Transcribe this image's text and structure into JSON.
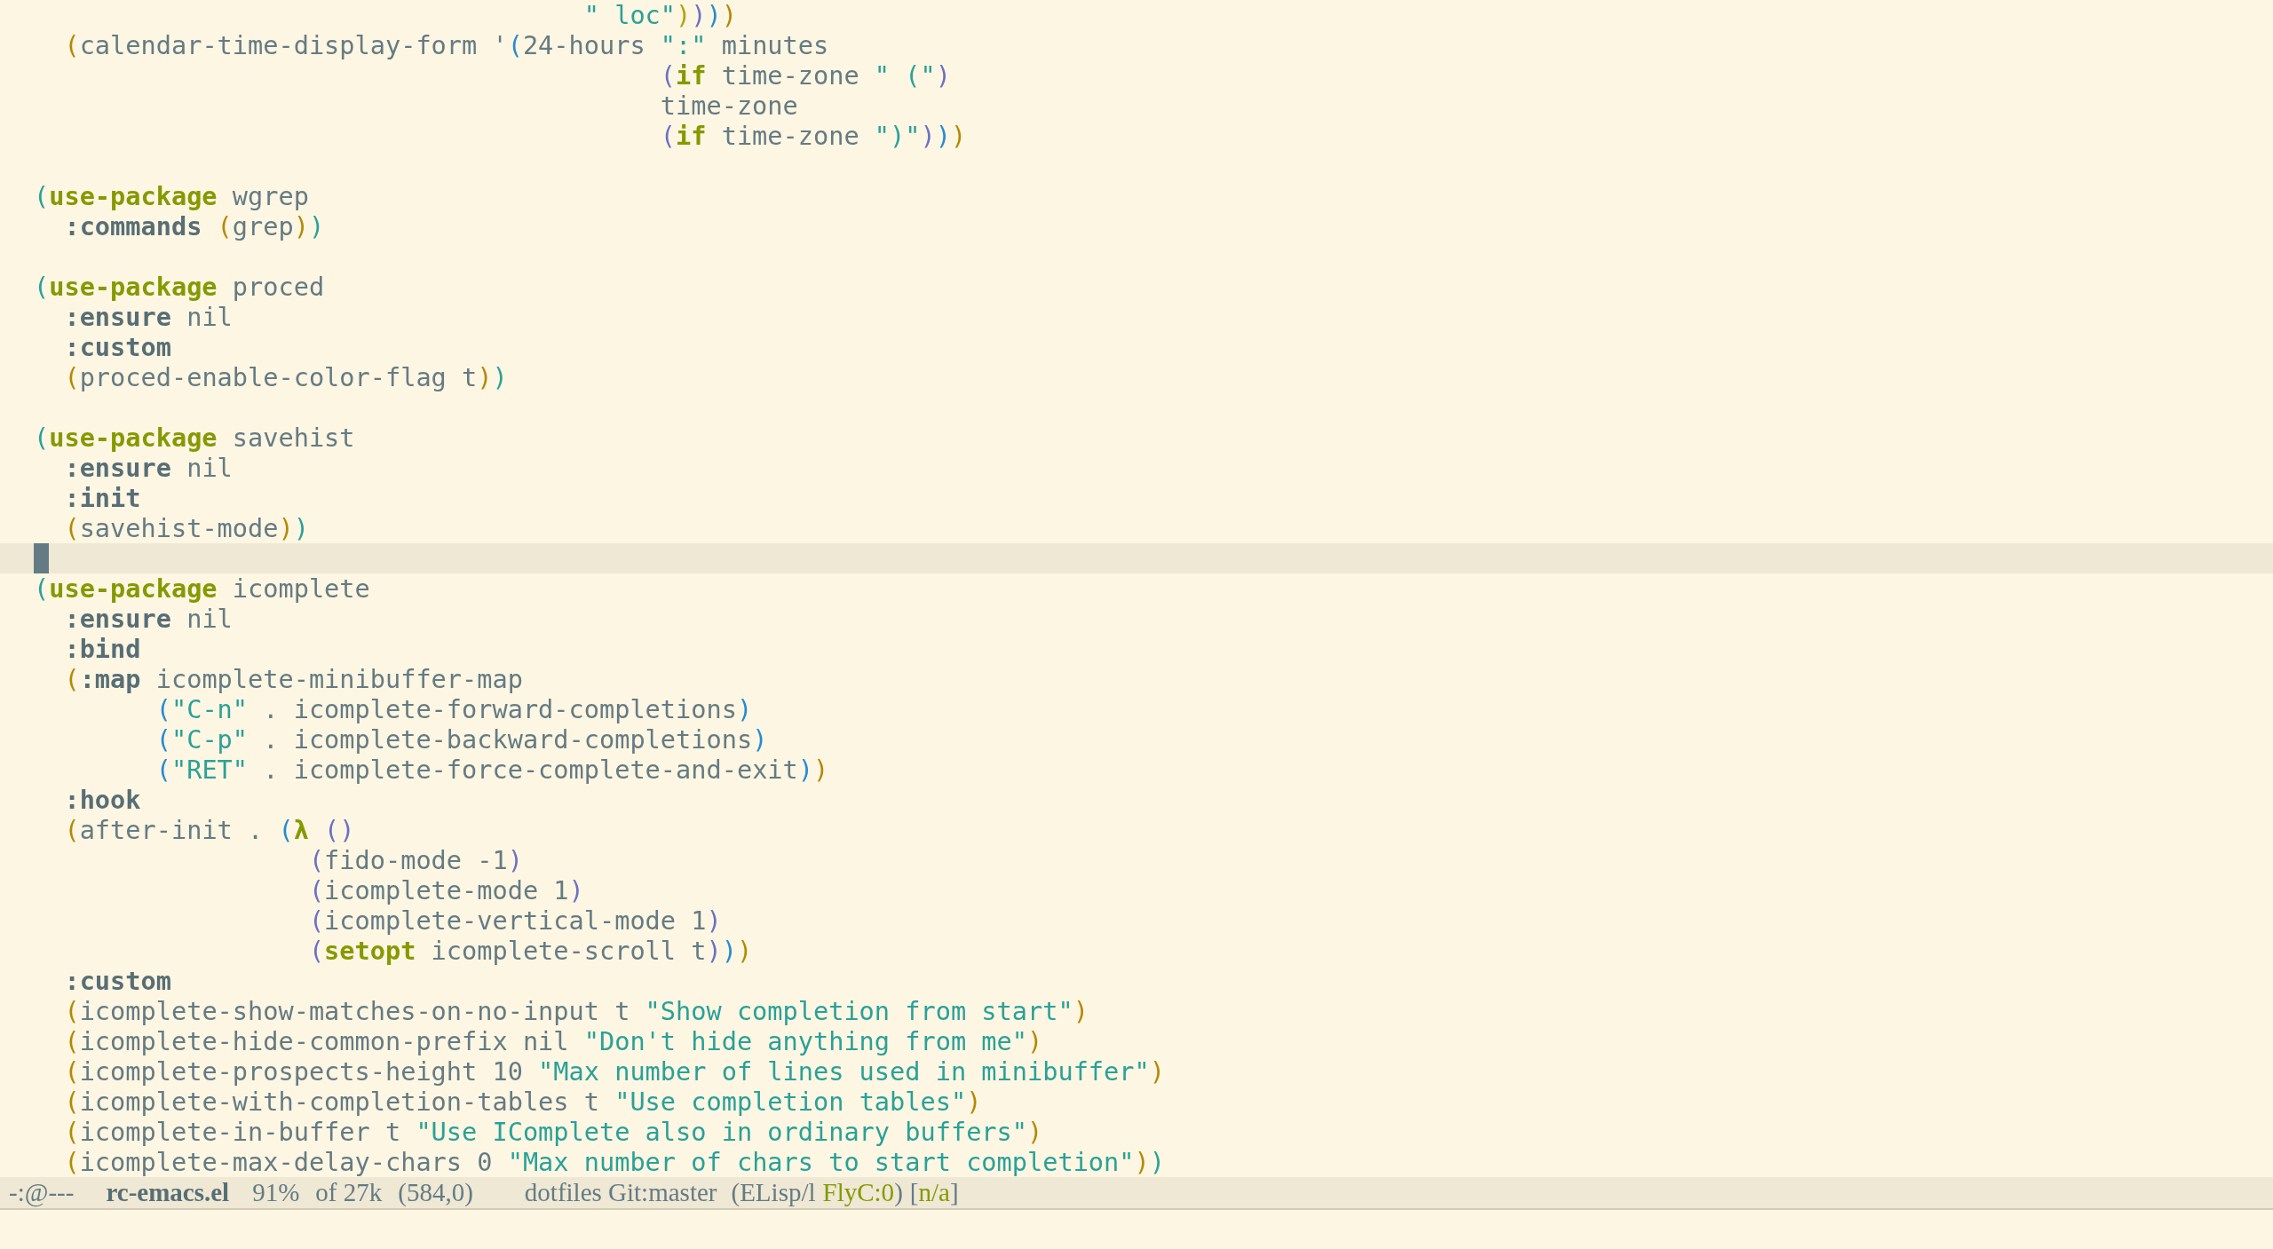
{
  "lines": [
    {
      "current": false,
      "tokens": [
        {
          "kind": "string",
          "text": "                                    \" loc\""
        },
        {
          "kind": "paren",
          "text": ")",
          "color": "#b3a300"
        },
        {
          "kind": "paren",
          "text": ")",
          "color": "#6c71c4"
        },
        {
          "kind": "paren",
          "text": ")",
          "color": "#268bd2"
        },
        {
          "kind": "paren",
          "text": ")",
          "color": "#b58900"
        }
      ]
    },
    {
      "current": false,
      "tokens": [
        {
          "kind": "paren",
          "text": "  (",
          "color": "#b58900"
        },
        {
          "kind": "plain",
          "text": "calendar-time-display-form '"
        },
        {
          "kind": "paren",
          "text": "(",
          "color": "#268bd2"
        },
        {
          "kind": "plain",
          "text": "24-hours "
        },
        {
          "kind": "string",
          "text": "\":\""
        },
        {
          "kind": "plain",
          "text": " minutes"
        }
      ]
    },
    {
      "current": false,
      "tokens": [
        {
          "kind": "paren",
          "text": "                                         (",
          "color": "#6c71c4"
        },
        {
          "kind": "keyword",
          "text": "if"
        },
        {
          "kind": "plain",
          "text": " time-zone "
        },
        {
          "kind": "string",
          "text": "\" (\""
        },
        {
          "kind": "paren",
          "text": ")",
          "color": "#6c71c4"
        }
      ]
    },
    {
      "current": false,
      "tokens": [
        {
          "kind": "plain",
          "text": "                                         time-zone"
        }
      ]
    },
    {
      "current": false,
      "tokens": [
        {
          "kind": "paren",
          "text": "                                         (",
          "color": "#6c71c4"
        },
        {
          "kind": "keyword",
          "text": "if"
        },
        {
          "kind": "plain",
          "text": " time-zone "
        },
        {
          "kind": "string",
          "text": "\")\""
        },
        {
          "kind": "paren",
          "text": ")",
          "color": "#6c71c4"
        },
        {
          "kind": "paren",
          "text": ")",
          "color": "#268bd2"
        },
        {
          "kind": "paren",
          "text": ")",
          "color": "#b58900"
        }
      ]
    },
    {
      "current": false
    },
    {
      "current": false,
      "tokens": [
        {
          "kind": "paren",
          "text": "(",
          "color": "#2aa198"
        },
        {
          "kind": "keyword",
          "text": "use-package"
        },
        {
          "kind": "plain",
          "text": " wgrep"
        }
      ]
    },
    {
      "current": false,
      "tokens": [
        {
          "kind": "property",
          "text": "  :commands"
        },
        {
          "kind": "paren",
          "text": " (",
          "color": "#b58900"
        },
        {
          "kind": "plain",
          "text": "grep"
        },
        {
          "kind": "paren",
          "text": ")",
          "color": "#b58900"
        },
        {
          "kind": "paren",
          "text": ")",
          "color": "#2aa198"
        }
      ]
    },
    {
      "current": false
    },
    {
      "current": false,
      "tokens": [
        {
          "kind": "paren",
          "text": "(",
          "color": "#2aa198"
        },
        {
          "kind": "keyword",
          "text": "use-package"
        },
        {
          "kind": "plain",
          "text": " proced"
        }
      ]
    },
    {
      "current": false,
      "tokens": [
        {
          "kind": "property",
          "text": "  :ensure"
        },
        {
          "kind": "plain",
          "text": " nil"
        }
      ]
    },
    {
      "current": false,
      "tokens": [
        {
          "kind": "property",
          "text": "  :custom"
        }
      ]
    },
    {
      "current": false,
      "tokens": [
        {
          "kind": "paren",
          "text": "  (",
          "color": "#b58900"
        },
        {
          "kind": "plain",
          "text": "proced-enable-color-flag t"
        },
        {
          "kind": "paren",
          "text": ")",
          "color": "#b58900"
        },
        {
          "kind": "paren",
          "text": ")",
          "color": "#2aa198"
        }
      ]
    },
    {
      "current": false
    },
    {
      "current": false,
      "tokens": [
        {
          "kind": "paren",
          "text": "(",
          "color": "#2aa198"
        },
        {
          "kind": "keyword",
          "text": "use-package"
        },
        {
          "kind": "plain",
          "text": " savehist"
        }
      ]
    },
    {
      "current": false,
      "tokens": [
        {
          "kind": "property",
          "text": "  :ensure"
        },
        {
          "kind": "plain",
          "text": " nil"
        }
      ]
    },
    {
      "current": false,
      "tokens": [
        {
          "kind": "property",
          "text": "  :init"
        }
      ]
    },
    {
      "current": false,
      "tokens": [
        {
          "kind": "paren",
          "text": "  (",
          "color": "#b58900"
        },
        {
          "kind": "plain",
          "text": "savehist-mode"
        },
        {
          "kind": "paren",
          "text": ")",
          "color": "#b58900"
        },
        {
          "kind": "paren",
          "text": ")",
          "color": "#2aa198"
        }
      ]
    },
    {
      "current": true
    },
    {
      "current": false,
      "tokens": [
        {
          "kind": "paren",
          "text": "(",
          "color": "#2aa198"
        },
        {
          "kind": "keyword",
          "text": "use-package"
        },
        {
          "kind": "plain",
          "text": " icomplete"
        }
      ]
    },
    {
      "current": false,
      "tokens": [
        {
          "kind": "property",
          "text": "  :ensure"
        },
        {
          "kind": "plain",
          "text": " nil"
        }
      ]
    },
    {
      "current": false,
      "tokens": [
        {
          "kind": "property",
          "text": "  :bind"
        }
      ]
    },
    {
      "current": false,
      "tokens": [
        {
          "kind": "paren",
          "text": "  (",
          "color": "#b58900"
        },
        {
          "kind": "property",
          "text": ":map"
        },
        {
          "kind": "plain",
          "text": " icomplete-minibuffer-map"
        }
      ]
    },
    {
      "current": false,
      "tokens": [
        {
          "kind": "paren",
          "text": "        (",
          "color": "#268bd2"
        },
        {
          "kind": "string",
          "text": "\"C-n\""
        },
        {
          "kind": "plain",
          "text": " . icomplete-forward-completions"
        },
        {
          "kind": "paren",
          "text": ")",
          "color": "#268bd2"
        }
      ]
    },
    {
      "current": false,
      "tokens": [
        {
          "kind": "paren",
          "text": "        (",
          "color": "#268bd2"
        },
        {
          "kind": "string",
          "text": "\"C-p\""
        },
        {
          "kind": "plain",
          "text": " . icomplete-backward-completions"
        },
        {
          "kind": "paren",
          "text": ")",
          "color": "#268bd2"
        }
      ]
    },
    {
      "current": false,
      "tokens": [
        {
          "kind": "paren",
          "text": "        (",
          "color": "#268bd2"
        },
        {
          "kind": "string",
          "text": "\"RET\""
        },
        {
          "kind": "plain",
          "text": " . icomplete-force-complete-and-exit"
        },
        {
          "kind": "paren",
          "text": ")",
          "color": "#268bd2"
        },
        {
          "kind": "paren",
          "text": ")",
          "color": "#b58900"
        }
      ]
    },
    {
      "current": false,
      "tokens": [
        {
          "kind": "property",
          "text": "  :hook"
        }
      ]
    },
    {
      "current": false,
      "tokens": [
        {
          "kind": "paren",
          "text": "  (",
          "color": "#b58900"
        },
        {
          "kind": "plain",
          "text": "after-init . "
        },
        {
          "kind": "paren",
          "text": "(",
          "color": "#268bd2"
        },
        {
          "kind": "keyword",
          "text": "λ"
        },
        {
          "kind": "paren",
          "text": " (",
          "color": "#6c71c4"
        },
        {
          "kind": "paren",
          "text": ")",
          "color": "#6c71c4"
        }
      ]
    },
    {
      "current": false,
      "tokens": [
        {
          "kind": "paren",
          "text": "                  (",
          "color": "#6c71c4"
        },
        {
          "kind": "plain",
          "text": "fido-mode -1"
        },
        {
          "kind": "paren",
          "text": ")",
          "color": "#6c71c4"
        }
      ]
    },
    {
      "current": false,
      "tokens": [
        {
          "kind": "paren",
          "text": "                  (",
          "color": "#6c71c4"
        },
        {
          "kind": "plain",
          "text": "icomplete-mode 1"
        },
        {
          "kind": "paren",
          "text": ")",
          "color": "#6c71c4"
        }
      ]
    },
    {
      "current": false,
      "tokens": [
        {
          "kind": "paren",
          "text": "                  (",
          "color": "#6c71c4"
        },
        {
          "kind": "plain",
          "text": "icomplete-vertical-mode 1"
        },
        {
          "kind": "paren",
          "text": ")",
          "color": "#6c71c4"
        }
      ]
    },
    {
      "current": false,
      "tokens": [
        {
          "kind": "paren",
          "text": "                  (",
          "color": "#6c71c4"
        },
        {
          "kind": "keyword",
          "text": "setopt"
        },
        {
          "kind": "plain",
          "text": " icomplete-scroll t"
        },
        {
          "kind": "paren",
          "text": ")",
          "color": "#6c71c4"
        },
        {
          "kind": "paren",
          "text": ")",
          "color": "#268bd2"
        },
        {
          "kind": "paren",
          "text": ")",
          "color": "#b58900"
        }
      ]
    },
    {
      "current": false,
      "tokens": [
        {
          "kind": "property",
          "text": "  :custom"
        }
      ]
    },
    {
      "current": false,
      "tokens": [
        {
          "kind": "paren",
          "text": "  (",
          "color": "#b58900"
        },
        {
          "kind": "plain",
          "text": "icomplete-show-matches-on-no-input t "
        },
        {
          "kind": "string",
          "text": "\"Show completion from start\""
        },
        {
          "kind": "paren",
          "text": ")",
          "color": "#b58900"
        }
      ]
    },
    {
      "current": false,
      "tokens": [
        {
          "kind": "paren",
          "text": "  (",
          "color": "#b58900"
        },
        {
          "kind": "plain",
          "text": "icomplete-hide-common-prefix nil "
        },
        {
          "kind": "string",
          "text": "\"Don't hide anything from me\""
        },
        {
          "kind": "paren",
          "text": ")",
          "color": "#b58900"
        }
      ]
    },
    {
      "current": false,
      "tokens": [
        {
          "kind": "paren",
          "text": "  (",
          "color": "#b58900"
        },
        {
          "kind": "plain",
          "text": "icomplete-prospects-height 10 "
        },
        {
          "kind": "string",
          "text": "\"Max number of lines used in minibuffer\""
        },
        {
          "kind": "paren",
          "text": ")",
          "color": "#b58900"
        }
      ]
    },
    {
      "current": false,
      "tokens": [
        {
          "kind": "paren",
          "text": "  (",
          "color": "#b58900"
        },
        {
          "kind": "plain",
          "text": "icomplete-with-completion-tables t "
        },
        {
          "kind": "string",
          "text": "\"Use completion tables\""
        },
        {
          "kind": "paren",
          "text": ")",
          "color": "#b58900"
        }
      ]
    },
    {
      "current": false,
      "tokens": [
        {
          "kind": "paren",
          "text": "  (",
          "color": "#b58900"
        },
        {
          "kind": "plain",
          "text": "icomplete-in-buffer t "
        },
        {
          "kind": "string",
          "text": "\"Use IComplete also in ordinary buffers\""
        },
        {
          "kind": "paren",
          "text": ")",
          "color": "#b58900"
        }
      ]
    },
    {
      "current": false,
      "tokens": [
        {
          "kind": "paren",
          "text": "  (",
          "color": "#b58900"
        },
        {
          "kind": "plain",
          "text": "icomplete-max-delay-chars 0 "
        },
        {
          "kind": "string",
          "text": "\"Max number of chars to start completion\""
        },
        {
          "kind": "paren",
          "text": ")",
          "color": "#b58900"
        },
        {
          "kind": "paren",
          "text": ")",
          "color": "#2aa198"
        }
      ]
    }
  ],
  "mode_line": [
    {
      "kind": "status",
      "text": "-:@---"
    },
    {
      "kind": "buffer",
      "text": "rc-emacs.el"
    },
    {
      "kind": "percent",
      "text": "91%"
    },
    {
      "kind": "size",
      "text": "of 27k"
    },
    {
      "kind": "position",
      "text": "(584,0)"
    },
    {
      "kind": "vc",
      "text": "dotfiles Git:master"
    },
    {
      "kind": "mode",
      "text": "(ELisp/l"
    },
    {
      "kind": "flycheck",
      "text": "FlyC:0"
    },
    {
      "kind": "mode_end",
      "text": ")"
    },
    {
      "kind": "bracket",
      "text": "["
    },
    {
      "kind": "project",
      "text": "n/a"
    },
    {
      "kind": "bracket_end",
      "text": "]"
    }
  ]
}
